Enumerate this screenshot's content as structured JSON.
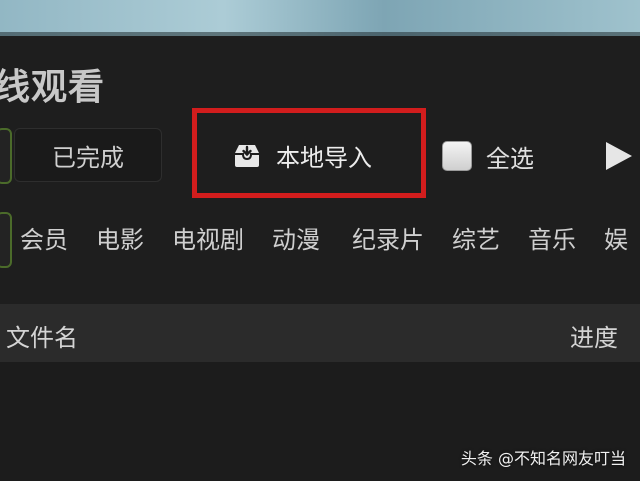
{
  "window": {
    "title": "线观看"
  },
  "tabs": {
    "done_label": "已完成"
  },
  "toolbar": {
    "import_label": "本地导入",
    "import_icon": "download-tray-icon",
    "select_all_label": "全选",
    "select_all_checked": false,
    "play_icon": "play-icon",
    "highlight_color": "#d21d1d"
  },
  "categories": [
    {
      "label": "会员"
    },
    {
      "label": "电影"
    },
    {
      "label": "电视剧"
    },
    {
      "label": "动漫"
    },
    {
      "label": "纪录片"
    },
    {
      "label": "综艺"
    },
    {
      "label": "音乐"
    },
    {
      "label": "娱"
    }
  ],
  "list": {
    "columns": {
      "name": "文件名",
      "progress": "进度"
    }
  },
  "watermark": "头条 @不知名网友叮当",
  "colors": {
    "accent_green": "#4b6b2a",
    "background": "#1e1e1e",
    "header_bg": "#2b2b2b"
  }
}
